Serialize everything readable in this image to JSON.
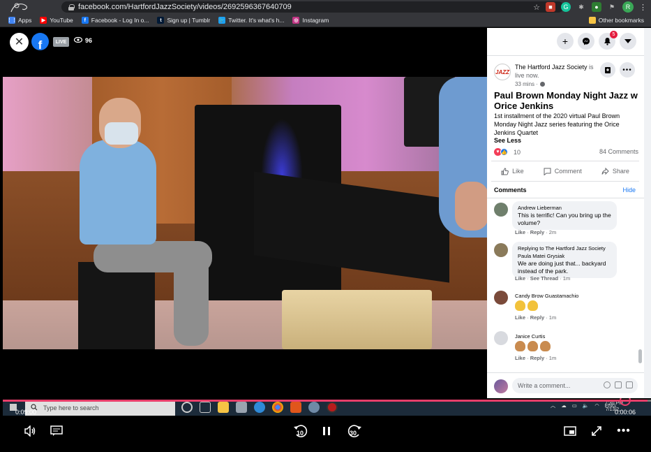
{
  "browser": {
    "url": "facebook.com/HartfordJazzSociety/videos/2692596367640709",
    "profile_initial": "R",
    "bookmarks": [
      {
        "label": "Apps",
        "color": "#4285f4",
        "glyph": "⋮⋮"
      },
      {
        "label": "YouTube",
        "color": "#ff0000",
        "glyph": "▶"
      },
      {
        "label": "Facebook - Log In o...",
        "color": "#1877f2",
        "glyph": "f"
      },
      {
        "label": "Sign up | Tumblr",
        "color": "#001935",
        "glyph": "t"
      },
      {
        "label": "Twitter. It's what's h...",
        "color": "#1da1f2",
        "glyph": "🐦"
      },
      {
        "label": "Instagram",
        "color": "#c13584",
        "glyph": "◎"
      }
    ],
    "other_bookmarks": "Other bookmarks"
  },
  "video": {
    "live_label": "LIVE",
    "viewers": "96",
    "time_elapsed": "0:09:00",
    "time_remaining": "0:00:06",
    "progress_fraction": 0.995
  },
  "taskbar": {
    "search_placeholder": "Type here to search",
    "lang": "ENG",
    "time": "7:30 PM",
    "date": "7/13/2..."
  },
  "controls": {
    "skip_back": "10",
    "skip_forward": "30"
  },
  "panel": {
    "notification_count": "5",
    "page_avatar_text": "JAZZ",
    "page_name": "The Hartford Jazz Society",
    "page_status": " is live now.",
    "post_time": "33 mins ·",
    "title": "Paul Brown Monday Night Jazz w Orice Jenkins",
    "description": "1st installment of the 2020 virtual Paul Brown Monday Night Jazz series featuring the Orice Jenkins Quartet",
    "see_less": "See Less",
    "reaction_count": "10",
    "comment_count": "84 Comments",
    "actions": {
      "like": "Like",
      "comment": "Comment",
      "share": "Share"
    },
    "comments_heading": "Comments",
    "hide_label": "Hide",
    "comments": [
      {
        "author": "Andrew Lieberman",
        "reply_to": "",
        "text": "This is terrific! Can you bring up the volume?",
        "emoji_count": 0,
        "like": "Like",
        "reply": "Reply",
        "extra": "",
        "age": "2m",
        "avatar_color": "#6f7f6c"
      },
      {
        "author": "Paula Matei Grysiak",
        "reply_to": "Replying to The Hartford Jazz Society",
        "text": "We are doing just that... backyard instead of the park.",
        "emoji_count": 0,
        "like": "Like",
        "reply": "",
        "extra": "See Thread",
        "age": "1m",
        "avatar_color": "#8a7a5a"
      },
      {
        "author": "Candy Brow Guastamachio",
        "reply_to": "",
        "text": "",
        "emoji_count": 2,
        "like": "Like",
        "reply": "Reply",
        "extra": "",
        "age": "1m",
        "avatar_color": "#7a4a3a"
      },
      {
        "author": "Janice Curtis",
        "reply_to": "",
        "text": "",
        "emoji_count": 3,
        "like": "Like",
        "reply": "Reply",
        "extra": "",
        "age": "1m",
        "avatar_color": "#d8dadf"
      }
    ],
    "write_comment_placeholder": "Write a comment..."
  },
  "colors": {
    "fb_blue": "#1877f2",
    "progress": "#e83e6a",
    "panel_bg": "#ffffff"
  }
}
